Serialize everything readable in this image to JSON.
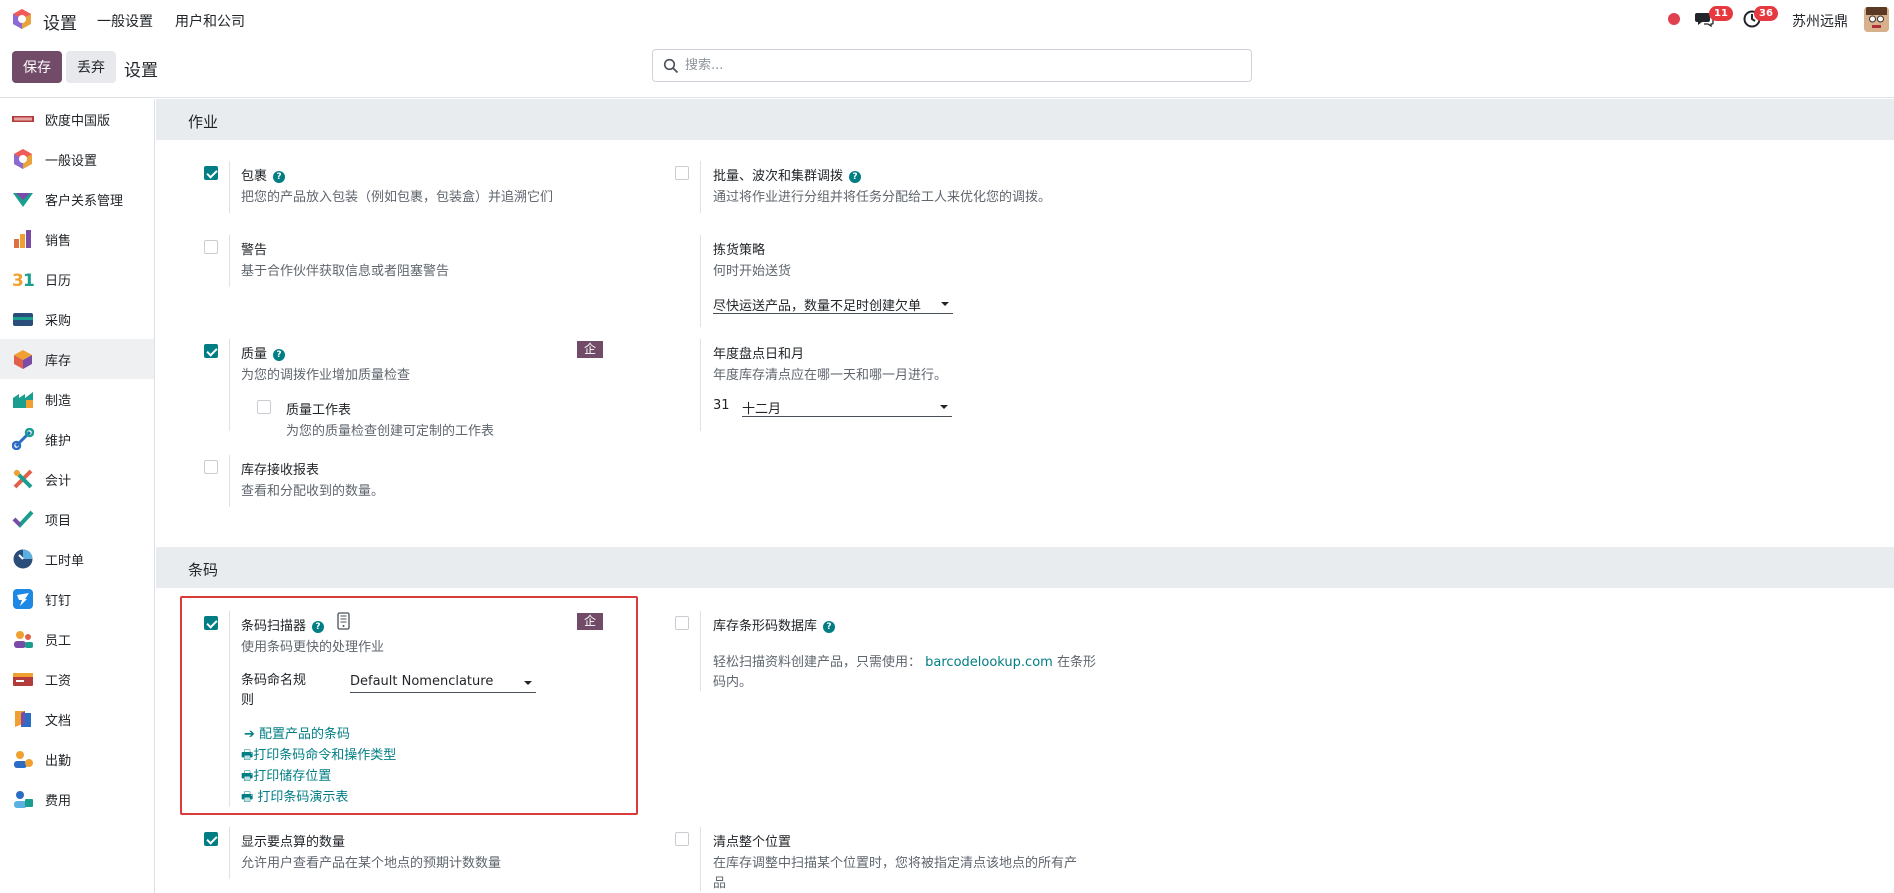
{
  "topbar": {
    "app_name": "设置",
    "menu": [
      "一般设置",
      "用户和公司"
    ],
    "messages_count": "11",
    "activities_count": "36",
    "company": "苏州远鼎",
    "colors": {
      "brand": "#714b67",
      "accent": "#017e84",
      "badge": "#e5393f"
    }
  },
  "control": {
    "save_label": "保存",
    "discard_label": "丢弃",
    "breadcrumb": "设置",
    "search_placeholder": "搜索..."
  },
  "sidebar": {
    "items": [
      {
        "label": "欧度中国版",
        "icon": "odoo-china-logo-icon"
      },
      {
        "label": "一般设置",
        "icon": "odoo-logo-icon"
      },
      {
        "label": "客户关系管理",
        "icon": "crm-icon"
      },
      {
        "label": "销售",
        "icon": "sales-chart-icon"
      },
      {
        "label": "日历",
        "icon": "calendar-icon"
      },
      {
        "label": "采购",
        "icon": "purchase-card-icon"
      },
      {
        "label": "库存",
        "icon": "inventory-box-icon",
        "active": true
      },
      {
        "label": "制造",
        "icon": "manufacturing-icon"
      },
      {
        "label": "维护",
        "icon": "maintenance-icon"
      },
      {
        "label": "会计",
        "icon": "accounting-icon"
      },
      {
        "label": "项目",
        "icon": "project-check-icon"
      },
      {
        "label": "工时单",
        "icon": "timesheet-clock-icon"
      },
      {
        "label": "钉钉",
        "icon": "dingtalk-icon"
      },
      {
        "label": "员工",
        "icon": "employees-icon"
      },
      {
        "label": "工资",
        "icon": "payroll-icon"
      },
      {
        "label": "文档",
        "icon": "documents-icon"
      },
      {
        "label": "出勤",
        "icon": "attendance-icon"
      },
      {
        "label": "费用",
        "icon": "expenses-icon"
      }
    ]
  },
  "operations": {
    "title": "作业",
    "packages": {
      "title": "包裹",
      "desc": "把您的产品放入包装（例如包裹，包装盒）并追溯它们",
      "checked": true
    },
    "batch": {
      "title": "批量、波次和集群调拨",
      "desc": "通过将作业进行分组并将任务分配给工人来优化您的调拨。",
      "checked": false
    },
    "warnings": {
      "title": "警告",
      "desc": "基于合作伙伴获取信息或者阻塞警告",
      "checked": false
    },
    "picking": {
      "title": "拣货策略",
      "desc": "何时开始送货",
      "value": "尽快运送产品，数量不足时创建欠单"
    },
    "quality": {
      "title": "质量",
      "desc": "为您的调拨作业增加质量检查",
      "checked": true,
      "badge": "企业"
    },
    "quality_ws": {
      "title": "质量工作表",
      "desc": "为您的质量检查创建可定制的工作表",
      "checked": false
    },
    "annual": {
      "title": "年度盘点日和月",
      "desc": "年度库存清点应在哪一天和哪一月进行。",
      "day": "31",
      "month": "十二月"
    },
    "receipt": {
      "title": "库存接收报表",
      "desc": "查看和分配收到的数量。",
      "checked": false
    }
  },
  "barcode": {
    "title": "条码",
    "scanner": {
      "title": "条码扫描器",
      "desc": "使用条码更快的处理作业",
      "checked": true,
      "badge": "企业",
      "nomenclature_label": "条码命名规则",
      "nomenclature_value": "Default Nomenclature"
    },
    "links": [
      "配置产品的条码",
      "打印条码命令和操作类型",
      "打印储存位置",
      "打印条码演示表"
    ],
    "db": {
      "title": "库存条形码数据库",
      "desc1": "轻松扫描资料创建产品，只需使用：",
      "link": "barcodelookup.com",
      "desc2": "在条形",
      "desc3": "码内。",
      "checked": false
    },
    "count": {
      "title": "显示要点算的数量",
      "desc": "允许用户查看产品在某个地点的预期计数数量",
      "checked": true
    },
    "full": {
      "title": "清点整个位置",
      "desc1": "在库存调整中扫描某个位置时，您将被指定清点该地点的所有产",
      "desc2": "品",
      "checked": false
    }
  }
}
